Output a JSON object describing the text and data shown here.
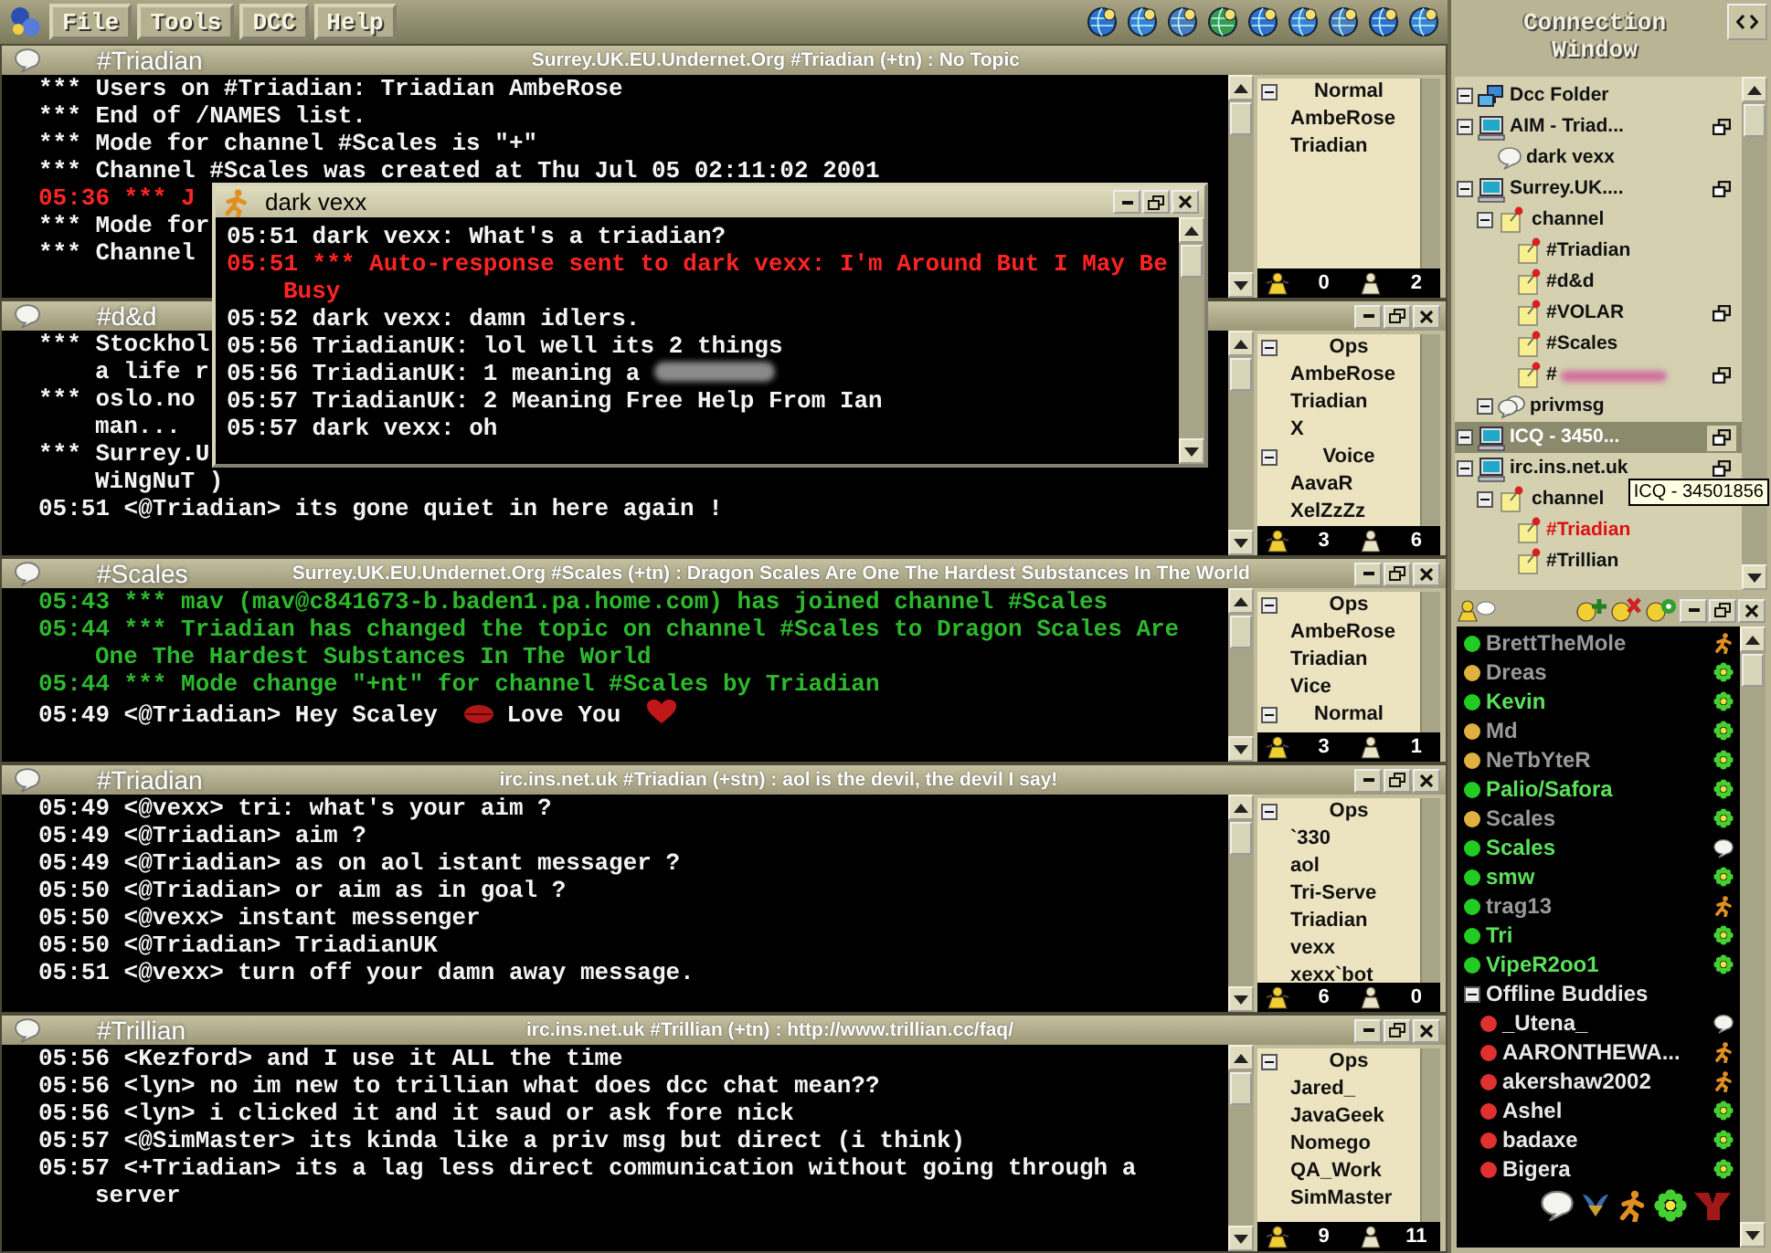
{
  "menu": {
    "items": [
      "File",
      "Tools",
      "DCC",
      "Help"
    ]
  },
  "windows": [
    {
      "channel": "#Triadian",
      "topic": "Surrey.UK.EU.Undernet.Org #Triadian (+tn) : No Topic",
      "controls": false,
      "lines": [
        {
          "kind": "text",
          "text": "*** Users on #Triadian: Triadian AmbeRose"
        },
        {
          "kind": "text",
          "text": "*** End of /NAMES list."
        },
        {
          "kind": "text",
          "text": "*** Mode for channel #Scales is \"+\""
        },
        {
          "kind": "text",
          "text": "*** Channel #Scales was created at Thu Jul 05 02:11:02 2001"
        },
        {
          "kind": "alert",
          "text": "05:36 *** J"
        },
        {
          "kind": "text",
          "text": "*** Mode for"
        },
        {
          "kind": "text",
          "text": "*** Channel"
        }
      ],
      "users": {
        "groups": [
          {
            "label": "Normal",
            "expanded": true,
            "members": [
              "AmbeRose",
              "Triadian"
            ]
          }
        ],
        "ops_count": "0",
        "others_count": "2"
      }
    },
    {
      "channel": "#d&d",
      "controls": true,
      "lines": [
        {
          "kind": "text",
          "text": "*** Stockhol"
        },
        {
          "kind": "cont",
          "text": "a life r"
        },
        {
          "kind": "text",
          "text": "*** oslo.no"
        },
        {
          "kind": "cont",
          "text": "man..."
        },
        {
          "kind": "text",
          "text": "*** Surrey.U"
        },
        {
          "kind": "cont",
          "text": "WiNgNuT )"
        },
        {
          "kind": "text",
          "text": "05:51 <@Triadian> its gone quiet in here again !"
        }
      ],
      "users": {
        "groups": [
          {
            "label": "Ops",
            "expanded": true,
            "members": [
              "AmbeRose",
              "Triadian",
              "X"
            ]
          },
          {
            "label": "Voice",
            "expanded": true,
            "members": [
              "AavaR",
              "XelZzZz"
            ]
          }
        ],
        "ops_count": "3",
        "others_count": "6"
      }
    },
    {
      "channel": "#Scales",
      "topic": "Surrey.UK.EU.Undernet.Org #Scales (+tn) : Dragon Scales Are One The Hardest Substances In The World",
      "controls": true,
      "lines": [
        {
          "kind": "event",
          "text": "05:43 *** mav (mav@c841673-b.baden1.pa.home.com) has joined channel #Scales"
        },
        {
          "kind": "event",
          "text": "05:44 *** Triadian has changed the topic on channel #Scales to Dragon Scales Are One The Hardest Substances In The World"
        },
        {
          "kind": "event",
          "text": "05:44 *** Mode change \"+nt\" for channel #Scales by Triadian"
        },
        {
          "kind": "text",
          "parts": [
            "05:49 <@Triadian> Hey Scaley",
            "Love You"
          ]
        }
      ],
      "users": {
        "groups": [
          {
            "label": "Ops",
            "expanded": true,
            "members": [
              "AmbeRose",
              "Triadian",
              "Vice"
            ]
          },
          {
            "label": "Normal",
            "expanded": true
          }
        ],
        "ops_count": "3",
        "others_count": "1"
      }
    },
    {
      "channel": "#Triadian",
      "topic": "irc.ins.net.uk #Triadian (+stn) : aol is the devil, the devil I say!",
      "controls": true,
      "lines": [
        {
          "kind": "text",
          "text": "05:49 <@vexx> tri: what's your aim ?"
        },
        {
          "kind": "text",
          "text": "05:49 <@Triadian> aim ?"
        },
        {
          "kind": "text",
          "text": "05:49 <@Triadian> as on aol istant messager ?"
        },
        {
          "kind": "text",
          "text": "05:50 <@Triadian> or aim as in goal ?"
        },
        {
          "kind": "text",
          "text": "05:50 <@vexx> instant messenger"
        },
        {
          "kind": "text",
          "text": "05:50 <@Triadian> TriadianUK"
        },
        {
          "kind": "text",
          "text": "05:51 <@vexx> turn off your damn away message."
        }
      ],
      "users": {
        "groups": [
          {
            "label": "Ops",
            "expanded": true,
            "members": [
              "`330",
              "aol",
              "Tri-Serve",
              "Triadian",
              "vexx",
              "xexx`bot"
            ]
          }
        ],
        "ops_count": "6",
        "others_count": "0"
      }
    },
    {
      "channel": "#Trillian",
      "topic": "irc.ins.net.uk #Trillian (+tn) : http://www.trillian.cc/faq/",
      "controls": true,
      "lines": [
        {
          "kind": "text",
          "text": "05:56 <Kezford> and I use it ALL the time"
        },
        {
          "kind": "text",
          "text": "05:56 <lyn> no im new to trillian what does dcc chat mean??"
        },
        {
          "kind": "text",
          "text": "05:56 <lyn> i clicked it and it saud or ask fore nick"
        },
        {
          "kind": "text",
          "text": "05:57 <@SimMaster> its kinda like a priv msg but direct (i think)"
        },
        {
          "kind": "text",
          "text": "05:57 <+Triadian> its a lag less direct communication without going through a server"
        }
      ],
      "users": {
        "groups": [
          {
            "label": "Ops",
            "expanded": true,
            "members": [
              "Jared_",
              "JavaGeek",
              "Nomego",
              "QA_Work",
              "SimMaster"
            ]
          }
        ],
        "ops_count": "9",
        "others_count": "11"
      }
    }
  ],
  "popup": {
    "title": "dark vexx",
    "lines": [
      {
        "kind": "text",
        "text": "05:51 dark vexx: What's a triadian?"
      },
      {
        "kind": "alert",
        "text": "05:51 *** Auto-response sent to dark vexx: I'm Around But I May Be Busy"
      },
      {
        "kind": "text",
        "text": "05:52 dark vexx: damn idlers."
      },
      {
        "kind": "text",
        "text": "05:56 TriadianUK: lol well its 2 things"
      },
      {
        "kind": "text",
        "text": "05:56 TriadianUK: 1 meaning a",
        "redacted": true
      },
      {
        "kind": "text",
        "text": "05:57 TriadianUK: 2 Meaning Free Help From Ian"
      },
      {
        "kind": "text",
        "text": "05:57 dark vexx: oh"
      }
    ]
  },
  "connection": {
    "title": "Connection Window",
    "tooltip": "ICQ - 34501856",
    "tree": [
      {
        "label": "Dcc Folder",
        "kind": "dcc",
        "expanded": true,
        "selected": false,
        "window": false
      },
      {
        "label": "AIM - Triad...",
        "kind": "server",
        "expanded": true,
        "selected": false,
        "window": true,
        "children": [
          {
            "label": "dark vexx",
            "kind": "query",
            "window": false
          }
        ]
      },
      {
        "label": "Surrey.UK....",
        "kind": "server",
        "expanded": true,
        "selected": false,
        "window": true,
        "children": [
          {
            "label": "channel",
            "kind": "folder",
            "expanded": true,
            "window": false,
            "children": [
              {
                "label": "#Triadian",
                "kind": "channel",
                "unread": false,
                "window": false
              },
              {
                "label": "#d&d",
                "kind": "channel",
                "unread": false,
                "window": false
              },
              {
                "label": "#VOLAR",
                "kind": "channel",
                "unread": false,
                "window": true
              },
              {
                "label": "#Scales",
                "kind": "channel",
                "unread": false,
                "window": false
              },
              {
                "label": "#",
                "kind": "channel",
                "unread": false,
                "window": true,
                "redacted": true
              }
            ]
          },
          {
            "label": "privmsg",
            "kind": "privmsg",
            "expanded": true,
            "window": false
          }
        ]
      },
      {
        "label": "ICQ - 3450...",
        "kind": "server",
        "expanded": true,
        "selected": true,
        "window": true
      },
      {
        "label": "irc.ins.net.uk",
        "kind": "server",
        "expanded": true,
        "selected": false,
        "window": true,
        "children": [
          {
            "label": "channel",
            "kind": "folder",
            "expanded": true,
            "window": false,
            "children": [
              {
                "label": "#Triadian",
                "kind": "channel",
                "unread": true,
                "window": false
              },
              {
                "label": "#Trillian",
                "kind": "channel",
                "unread": false,
                "window": false
              }
            ]
          }
        ]
      }
    ]
  },
  "buddies": {
    "online": [
      {
        "name": "BrettTheMole",
        "color": "#22cc22",
        "idle": true,
        "kind": "aim"
      },
      {
        "name": "Dreas",
        "color": "#e0b040",
        "idle": true,
        "kind": "icq"
      },
      {
        "name": "Kevin",
        "color": "#22cc22",
        "idle": false,
        "kind": "icq"
      },
      {
        "name": "Md",
        "color": "#e0b040",
        "idle": true,
        "kind": "icq"
      },
      {
        "name": "NeTbYteR",
        "color": "#e0b040",
        "idle": true,
        "kind": "icq"
      },
      {
        "name": "Palio/Safora",
        "color": "#22cc22",
        "idle": false,
        "kind": "icq"
      },
      {
        "name": "Scales",
        "color": "#e0b040",
        "idle": true,
        "kind": "icq"
      },
      {
        "name": "Scales",
        "color": "#22cc22",
        "idle": false,
        "kind": "irc"
      },
      {
        "name": "smw",
        "color": "#22cc22",
        "idle": false,
        "kind": "icq"
      },
      {
        "name": "trag13",
        "color": "#22cc22",
        "idle": true,
        "kind": "aim"
      },
      {
        "name": "Tri",
        "color": "#22cc22",
        "idle": false,
        "kind": "icq"
      },
      {
        "name": "VipeR2oo1",
        "color": "#22cc22",
        "idle": false,
        "kind": "icq"
      }
    ],
    "groups": [
      {
        "label": "Offline Buddies",
        "expanded": true,
        "buddies": [
          {
            "name": "_Utena_",
            "color": "#e03030",
            "kind": "irc"
          },
          {
            "name": "AARONTHEWA...",
            "color": "#e03030",
            "kind": "aim"
          },
          {
            "name": "akershaw2002",
            "color": "#e03030",
            "kind": "aim"
          },
          {
            "name": "Ashel",
            "color": "#e03030",
            "kind": "icq"
          },
          {
            "name": "badaxe",
            "color": "#e03030",
            "kind": "icq"
          },
          {
            "name": "Bigera",
            "color": "#e03030",
            "kind": "icq"
          }
        ]
      }
    ]
  }
}
